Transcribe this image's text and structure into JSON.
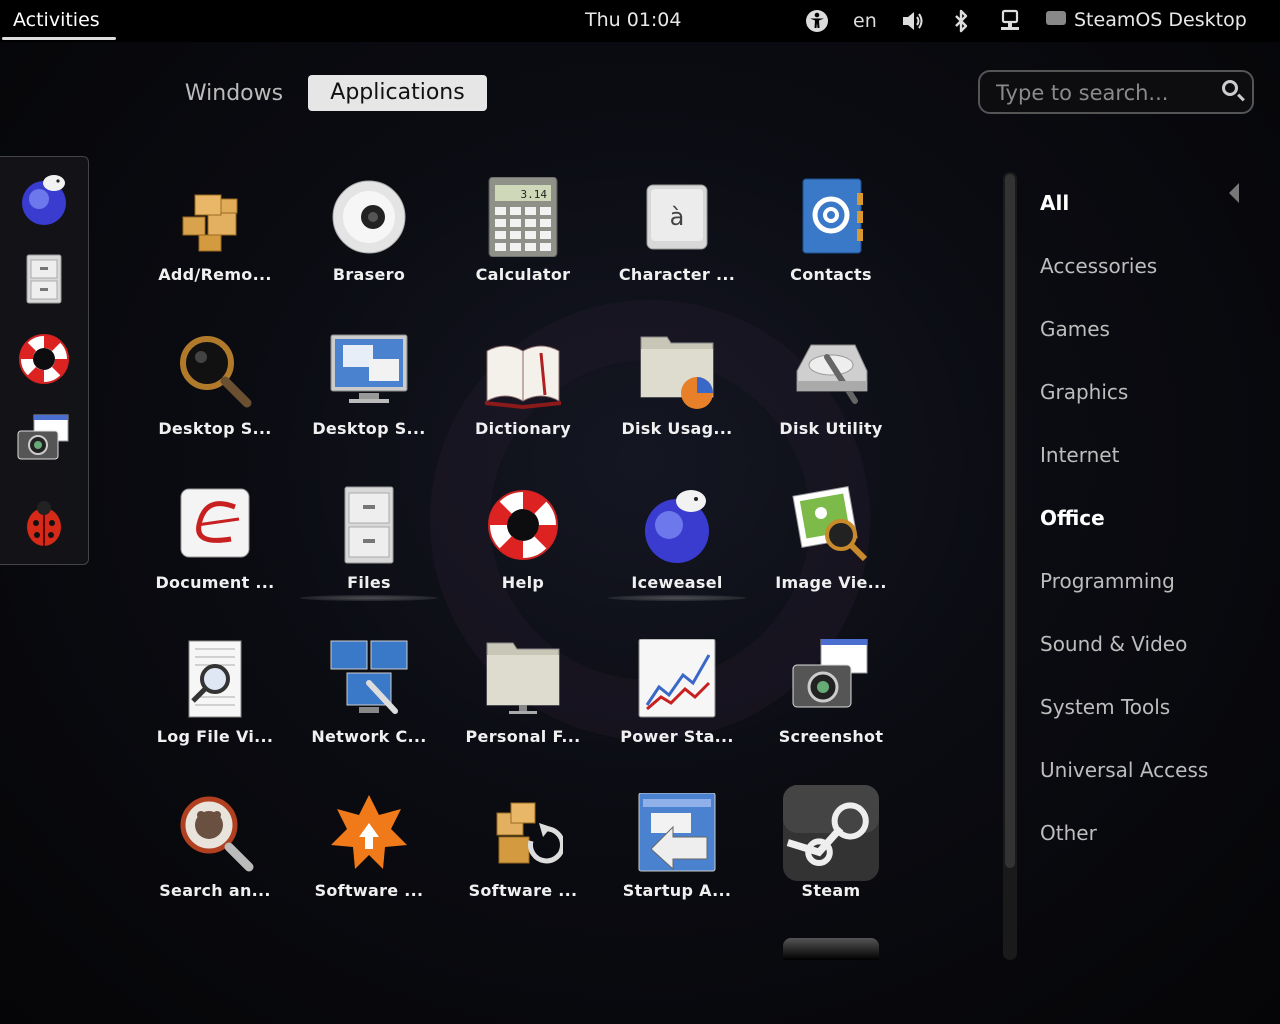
{
  "topbar": {
    "activities": "Activities",
    "clock": "Thu 01:04",
    "lang": "en",
    "user": "SteamOS Desktop",
    "icons": [
      "accessibility-icon",
      "volume-icon",
      "bluetooth-icon",
      "network-icon",
      "chat-icon"
    ]
  },
  "view": {
    "windows": "Windows",
    "applications": "Applications"
  },
  "search": {
    "placeholder": "Type to search..."
  },
  "dash": [
    "iceweasel-icon",
    "files-icon",
    "help-icon",
    "screenshot-icon",
    "bug-icon"
  ],
  "apps": [
    {
      "label": "Add/Remo...",
      "icon": "packages-icon"
    },
    {
      "label": "Brasero",
      "icon": "disc-icon"
    },
    {
      "label": "Calculator",
      "icon": "calculator-icon",
      "display": "3.14"
    },
    {
      "label": "Character ...",
      "icon": "character-map-icon",
      "glyph": "à"
    },
    {
      "label": "Contacts",
      "icon": "contacts-icon"
    },
    {
      "label": "Desktop S...",
      "icon": "magnifier-icon"
    },
    {
      "label": "Desktop S...",
      "icon": "monitor-icon"
    },
    {
      "label": "Dictionary",
      "icon": "book-icon"
    },
    {
      "label": "Disk Usag...",
      "icon": "disk-usage-icon"
    },
    {
      "label": "Disk Utility",
      "icon": "disk-utility-icon"
    },
    {
      "label": "Document ...",
      "icon": "document-viewer-icon"
    },
    {
      "label": "Files",
      "icon": "file-cabinet-icon"
    },
    {
      "label": "Help",
      "icon": "lifebuoy-icon"
    },
    {
      "label": "Iceweasel",
      "icon": "iceweasel-icon"
    },
    {
      "label": "Image Vie...",
      "icon": "image-viewer-icon"
    },
    {
      "label": "Log File Vi...",
      "icon": "log-viewer-icon"
    },
    {
      "label": "Network C...",
      "icon": "network-connections-icon"
    },
    {
      "label": "Personal F...",
      "icon": "folder-icon"
    },
    {
      "label": "Power Sta...",
      "icon": "power-stats-icon"
    },
    {
      "label": "Screenshot",
      "icon": "camera-icon"
    },
    {
      "label": "Search an...",
      "icon": "search-files-icon"
    },
    {
      "label": "Software ...",
      "icon": "software-update-icon"
    },
    {
      "label": "Software ...",
      "icon": "software-sources-icon"
    },
    {
      "label": "Startup A...",
      "icon": "startup-apps-icon"
    },
    {
      "label": "Steam",
      "icon": "steam-icon"
    }
  ],
  "categories": [
    {
      "label": "All",
      "active": true
    },
    {
      "label": "Accessories"
    },
    {
      "label": "Games"
    },
    {
      "label": "Graphics"
    },
    {
      "label": "Internet"
    },
    {
      "label": "Office",
      "active": true
    },
    {
      "label": "Programming"
    },
    {
      "label": "Sound & Video"
    },
    {
      "label": "System Tools"
    },
    {
      "label": "Universal Access"
    },
    {
      "label": "Other"
    }
  ]
}
